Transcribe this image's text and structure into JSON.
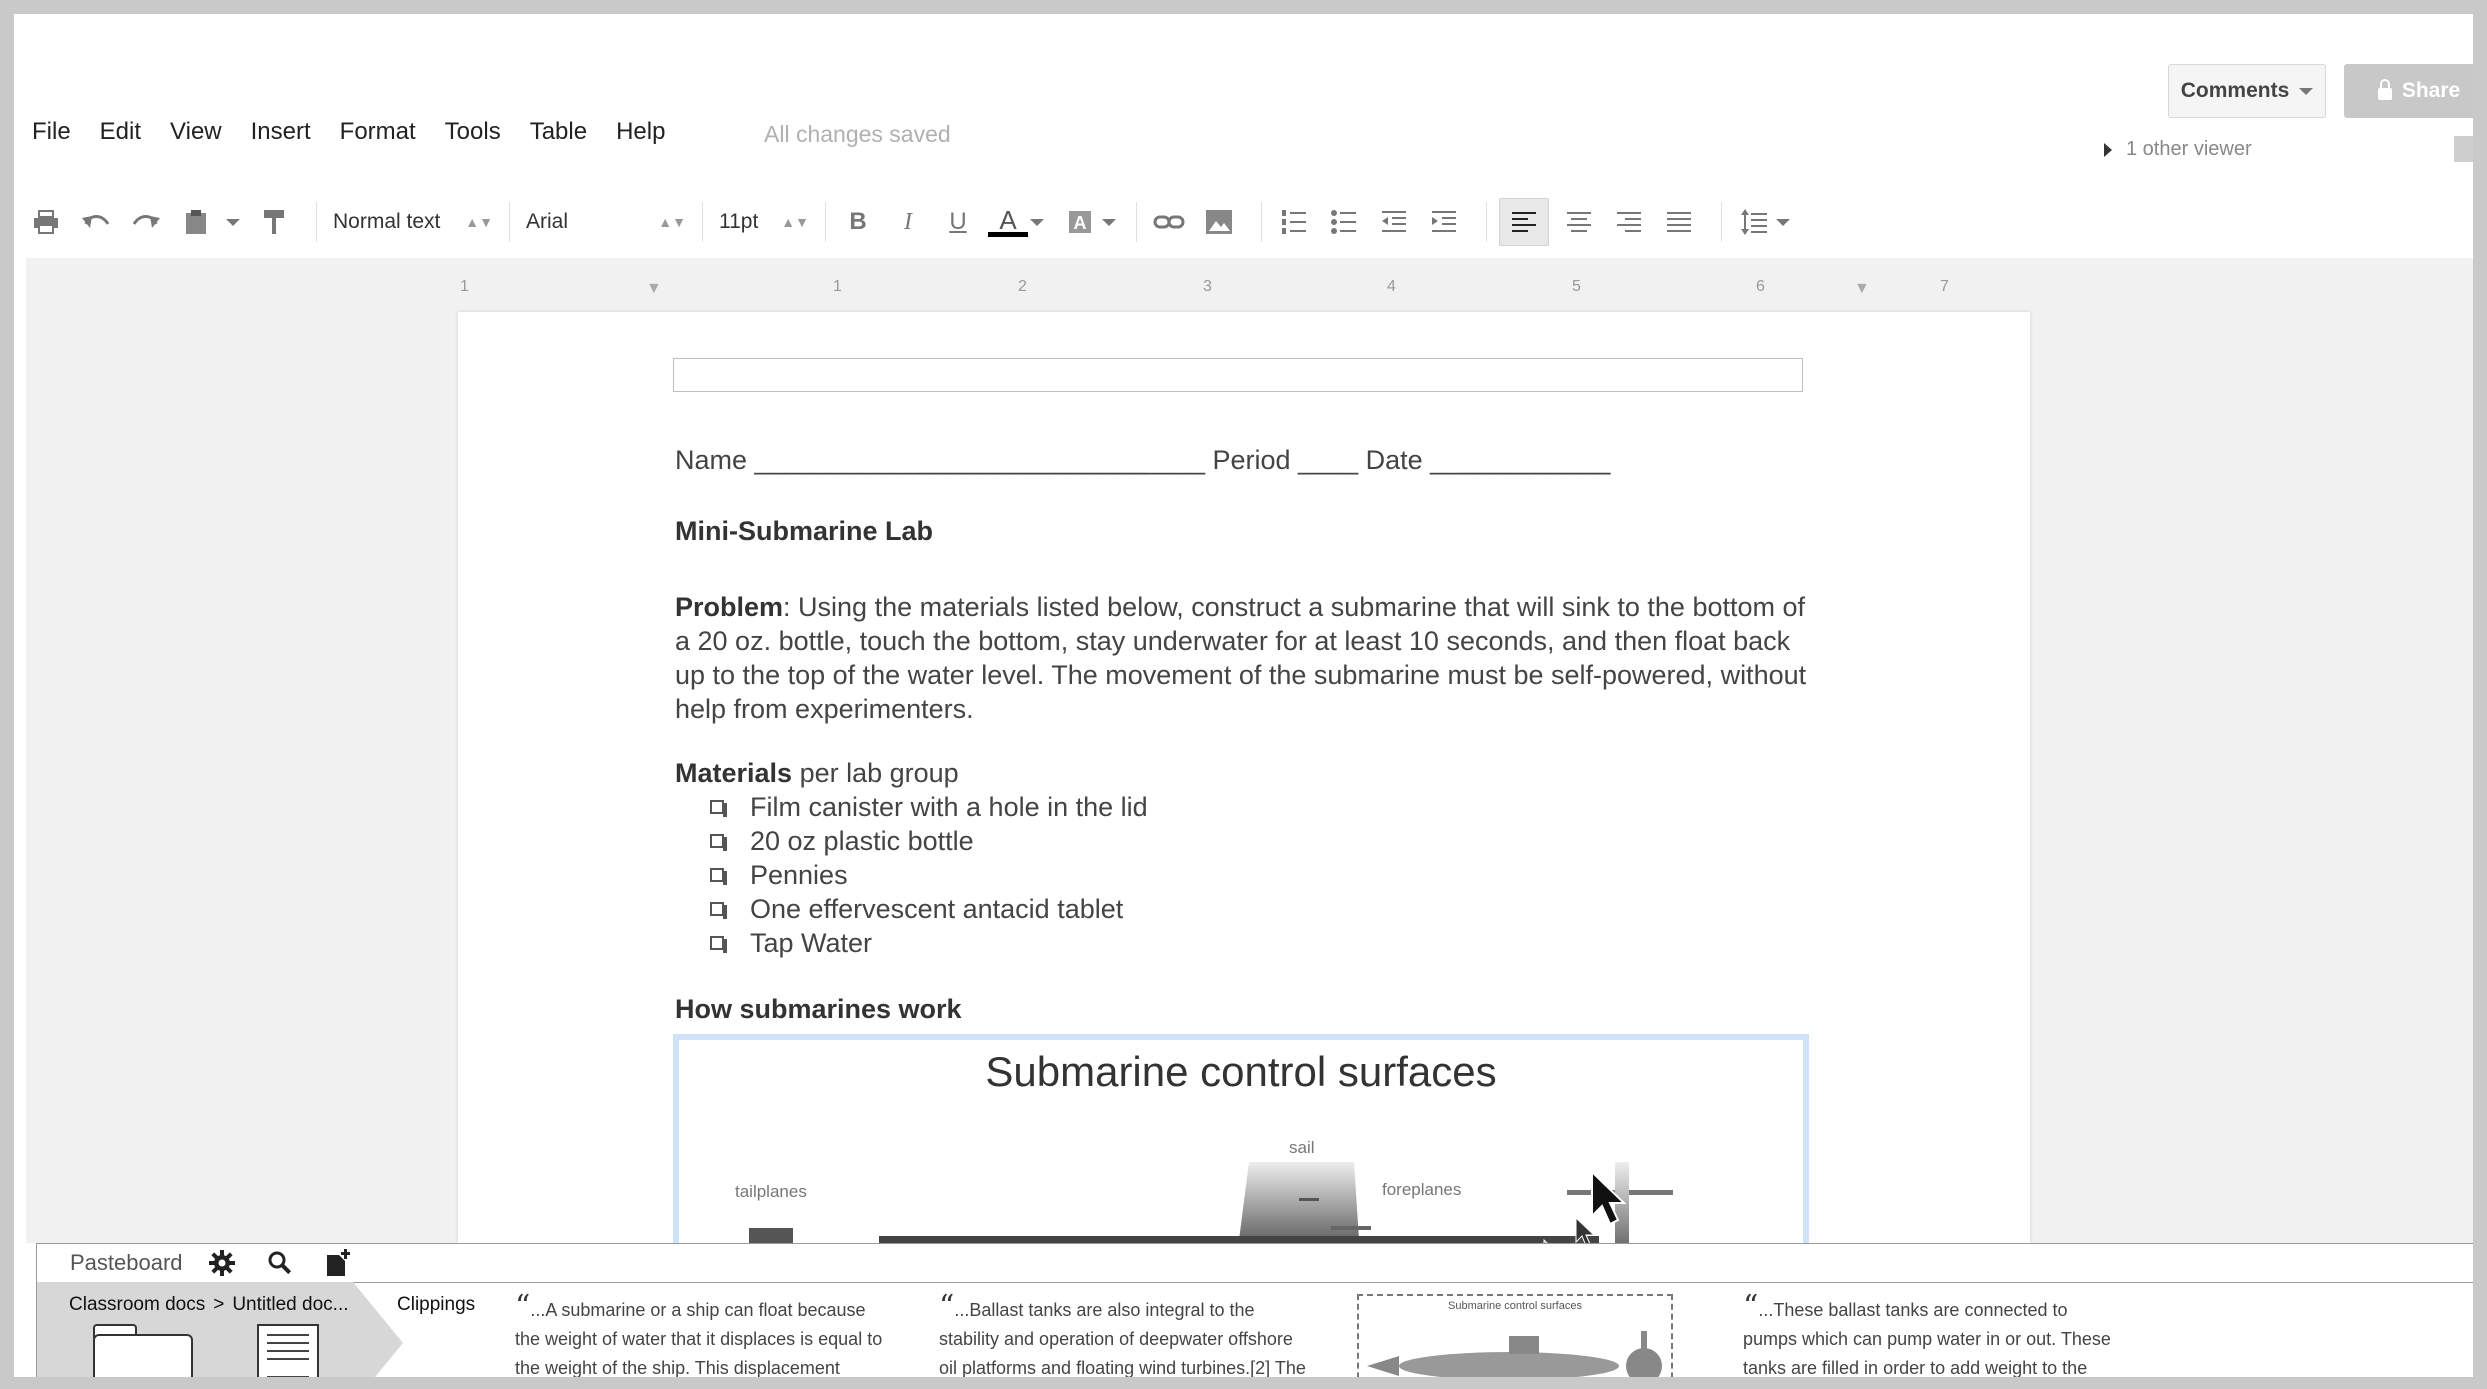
{
  "menu": [
    "File",
    "Edit",
    "View",
    "Insert",
    "Format",
    "Tools",
    "Table",
    "Help"
  ],
  "save_status": "All changes saved",
  "comments_label": "Comments",
  "share_label": "Share",
  "viewer_text": "1 other viewer",
  "toolbar": {
    "style": "Normal text",
    "font": "Arial",
    "size": "11pt",
    "bold": "B",
    "italic": "I",
    "underline": "U",
    "text_color": "A"
  },
  "ruler": [
    "1",
    "1",
    "2",
    "3",
    "4",
    "5",
    "6",
    "7"
  ],
  "doc": {
    "name_row": "Name ______________________________ Period ____ Date ____________",
    "title": "Mini-Submarine Lab",
    "problem_label": "Problem",
    "problem_text": ": Using the materials listed below, construct a submarine that will sink to the bottom of a 20 oz. bottle, touch the bottom, stay underwater for at least 10 seconds, and then float back up to the top of the water level. The movement of the submarine must be self-powered, without help from experimenters.",
    "materials_label": "Materials",
    "materials_suffix": " per lab group",
    "materials": [
      "Film canister with a hole in the lid",
      "20 oz plastic bottle",
      "Pennies",
      "One effervescent antacid tablet",
      "Tap Water"
    ],
    "section": "How submarines work",
    "figure_title": "Submarine control surfaces",
    "fig_labels": {
      "sail": "sail",
      "tailplanes": "tailplanes",
      "foreplanes": "foreplanes"
    }
  },
  "pasteboard": {
    "title": "Pasteboard",
    "crumb_a": "Classroom docs",
    "crumb_sep": ">",
    "crumb_b": "Untitled doc...",
    "clippings": "Clippings",
    "clip1": "...A submarine or a ship can float because the weight of water that it displaces is equal to the weight of the ship. This displacement of....",
    "clip2": "...Ballast tanks are also integral to the stability and operation of deepwater offshore oil platforms and floating wind turbines.[2] The ballast facilitates....",
    "clip3": "...These ballast tanks are connected to pumps which can pump water in or out. These tanks are filled in order to add weight to the ship once cargo...",
    "thumb_caption": "Submarine control surfaces"
  }
}
